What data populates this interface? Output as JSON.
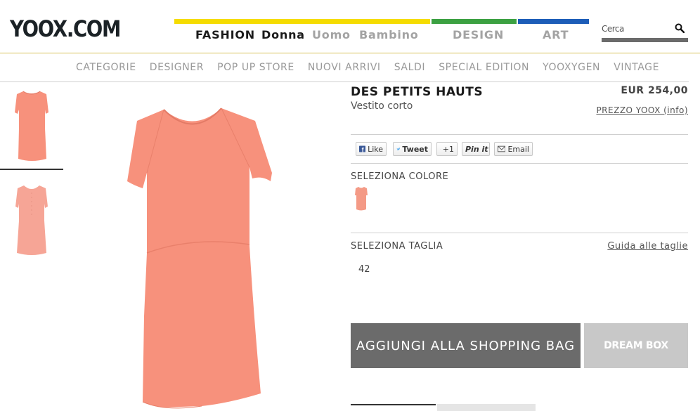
{
  "header": {
    "logo": "YOOX.COM",
    "nav": {
      "fashion": "FASHION",
      "donna": "Donna",
      "uomo": "Uomo",
      "bambino": "Bambino",
      "design": "DESIGN",
      "art": "ART"
    },
    "search_placeholder": "Cerca"
  },
  "subnav": [
    "CATEGORIE",
    "DESIGNER",
    "POP UP STORE",
    "NUOVI ARRIVI",
    "SALDI",
    "SPECIAL EDITION",
    "YOOXYGEN",
    "VINTAGE"
  ],
  "product": {
    "brand": "DES PETITS HAUTS",
    "subtitle": "Vestito corto",
    "price": "EUR 254,00",
    "price_link": "PREZZO YOOX (info)"
  },
  "social": {
    "like": "Like",
    "tweet": "Tweet",
    "gplus": "+1",
    "pinit": "Pin it",
    "email": "Email"
  },
  "color_section": {
    "label": "SELEZIONA COLORE",
    "swatch_color": "#f49a86"
  },
  "size_section": {
    "label": "SELEZIONA TAGLIA",
    "guide": "Guida alle taglie",
    "sizes": [
      "42"
    ]
  },
  "actions": {
    "add_to_bag": "AGGIUNGI ALLA SHOPPING BAG",
    "dream_box": "DREAM BOX"
  },
  "colors": {
    "dress": "#f7917c",
    "dress_shadow": "#e9806b",
    "dress_back": "#f6a596"
  }
}
